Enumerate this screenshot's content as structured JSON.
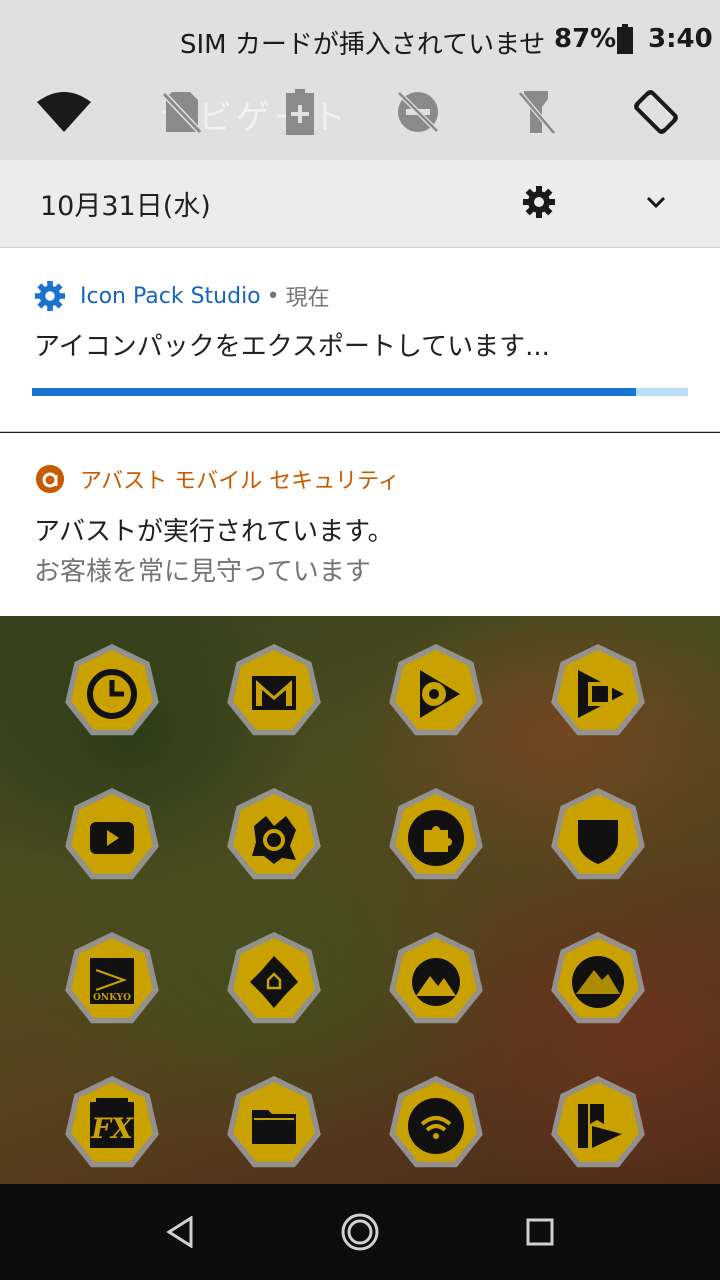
{
  "status_bar": {
    "carrier_text": "SIM カードが挿入されていません",
    "battery_percent": "87%",
    "battery_level": 0.87,
    "time": "3:40"
  },
  "quick_settings": {
    "tiles": [
      "wifi-icon",
      "sim-off-icon",
      "battery-saver-icon",
      "do-not-disturb-icon",
      "flashlight-off-icon",
      "auto-rotate-icon"
    ],
    "ghost_text": "ナビゲート",
    "date": "10月31日(水)"
  },
  "notifications": [
    {
      "app_name": "Icon Pack Studio",
      "time": "現在",
      "title": "アイコンパックをエクスポートしています...",
      "progress": 0.92,
      "accent": "#1565c0"
    },
    {
      "app_name": "アバスト モバイル セキュリティ",
      "title": "アバストが実行されています。",
      "subtitle": "お客様を常に見守っています",
      "accent": "#c85a00"
    }
  ],
  "home_icons": [
    "clock-icon",
    "gmail-icon",
    "play-music-icon",
    "play-movies-icon",
    "youtube-icon",
    "avast-icon",
    "puzzle-icon",
    "shield-icon",
    "onkyo-icon",
    "navigation-icon",
    "mountain-icon",
    "landscape-icon",
    "fx-icon",
    "folder-icon",
    "wifi-icon",
    "play-books-icon"
  ],
  "home_icon_labels": {
    "onkyo": "ONKYO",
    "fx": "FX"
  },
  "icon_theme": {
    "fill": "#c9a100",
    "rim": "#9a9a9a",
    "glyph": "#111111"
  },
  "nav_bar": [
    "back-icon",
    "home-icon",
    "recents-icon"
  ]
}
